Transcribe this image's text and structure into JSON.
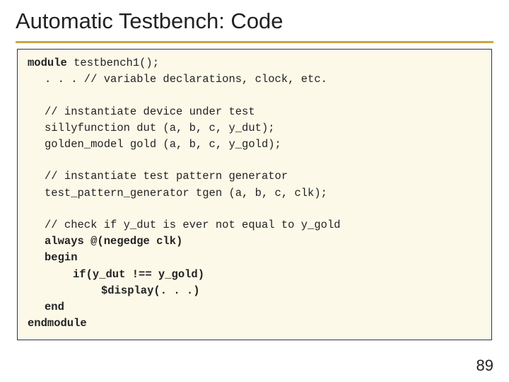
{
  "title": "Automatic Testbench: Code",
  "code": {
    "l1a": "module",
    "l1b": " testbench1();",
    "l2": ". . . // variable declarations, clock, etc.",
    "l3": "// instantiate device under test",
    "l4": "sillyfunction dut (a, b, c, y_dut);",
    "l5": "golden_model gold (a, b, c, y_gold);",
    "l6": "// instantiate test pattern generator",
    "l7": "test_pattern_generator tgen (a, b, c, clk);",
    "l8": "// check if y_dut is ever not equal to y_gold",
    "l9": "always @(negedge clk)",
    "l10": "begin",
    "l11": "if(y_dut !== y_gold)",
    "l12": "$display(. . .)",
    "l13": "end",
    "l14": "endmodule"
  },
  "page_number": "89"
}
